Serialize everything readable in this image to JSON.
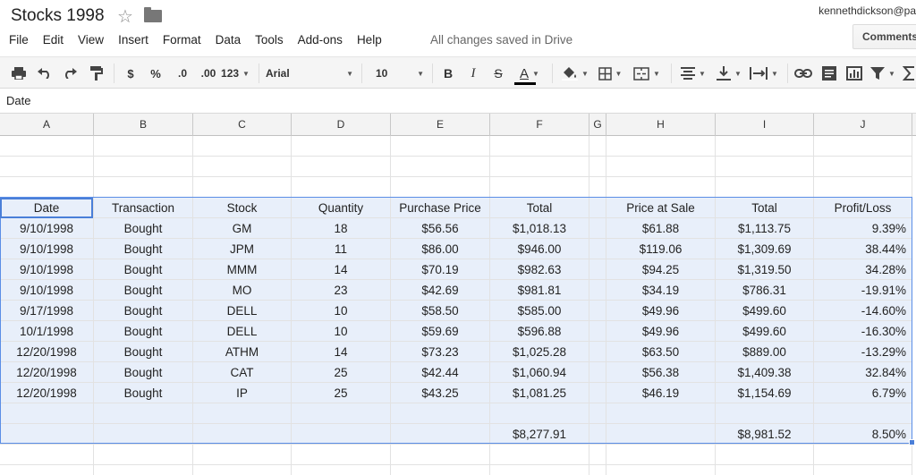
{
  "doc": {
    "title": "Stocks 1998",
    "user": "kennethdickson@pa",
    "comments_label": "Comments",
    "save_status": "All changes saved in Drive"
  },
  "menu": [
    "File",
    "Edit",
    "View",
    "Insert",
    "Format",
    "Data",
    "Tools",
    "Add-ons",
    "Help"
  ],
  "toolbar": {
    "currency": "$",
    "percent": "%",
    "decrease_decimals": ".0",
    "increase_decimals": ".00",
    "more_formats": "123",
    "font": "Arial",
    "font_size": "10",
    "bold": "B",
    "italic": "I",
    "strikethrough": "S",
    "text_color": "A",
    "text_color_value": "#000000"
  },
  "formula_bar": {
    "content": "Date"
  },
  "columns": [
    "A",
    "B",
    "C",
    "D",
    "E",
    "F",
    "G",
    "H",
    "I",
    "J"
  ],
  "headers": [
    "Date",
    "Transaction",
    "Stock",
    "Quantity",
    "Purchase Price",
    "Total",
    "",
    "Price at Sale",
    "Total",
    "Profit/Loss"
  ],
  "rows": [
    [
      "9/10/1998",
      "Bought",
      "GM",
      "18",
      "$56.56",
      "$1,018.13",
      "",
      "$61.88",
      "$1,113.75",
      "9.39%"
    ],
    [
      "9/10/1998",
      "Bought",
      "JPM",
      "11",
      "$86.00",
      "$946.00",
      "",
      "$119.06",
      "$1,309.69",
      "38.44%"
    ],
    [
      "9/10/1998",
      "Bought",
      "MMM",
      "14",
      "$70.19",
      "$982.63",
      "",
      "$94.25",
      "$1,319.50",
      "34.28%"
    ],
    [
      "9/10/1998",
      "Bought",
      "MO",
      "23",
      "$42.69",
      "$981.81",
      "",
      "$34.19",
      "$786.31",
      "-19.91%"
    ],
    [
      "9/17/1998",
      "Bought",
      "DELL",
      "10",
      "$58.50",
      "$585.00",
      "",
      "$49.96",
      "$499.60",
      "-14.60%"
    ],
    [
      "10/1/1998",
      "Bought",
      "DELL",
      "10",
      "$59.69",
      "$596.88",
      "",
      "$49.96",
      "$499.60",
      "-16.30%"
    ],
    [
      "12/20/1998",
      "Bought",
      "ATHM",
      "14",
      "$73.23",
      "$1,025.28",
      "",
      "$63.50",
      "$889.00",
      "-13.29%"
    ],
    [
      "12/20/1998",
      "Bought",
      "CAT",
      "25",
      "$42.44",
      "$1,060.94",
      "",
      "$56.38",
      "$1,409.38",
      "32.84%"
    ],
    [
      "12/20/1998",
      "Bought",
      "IP",
      "25",
      "$43.25",
      "$1,081.25",
      "",
      "$46.19",
      "$1,154.69",
      "6.79%"
    ]
  ],
  "totals": [
    "",
    "",
    "",
    "",
    "",
    "$8,277.91",
    "",
    "",
    "$8,981.52",
    "8.50%"
  ],
  "colors": {
    "selection": "#e8effa",
    "selection_border": "#5b8ee6"
  }
}
